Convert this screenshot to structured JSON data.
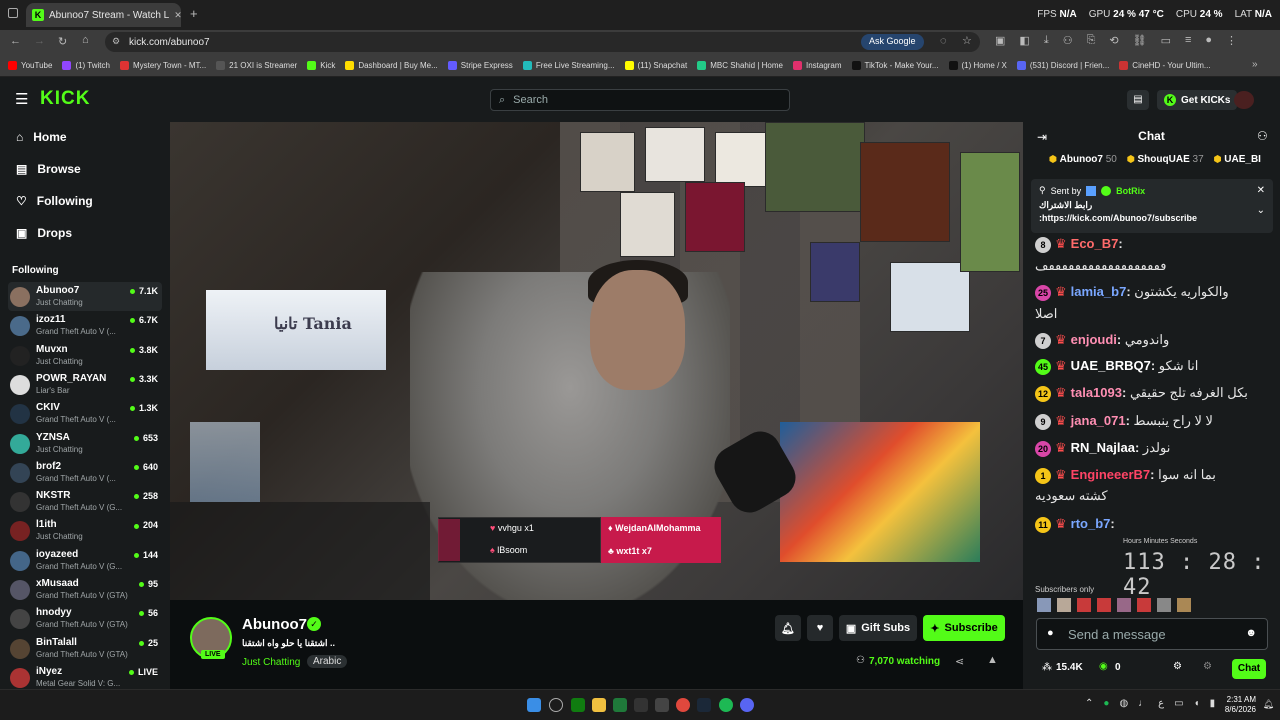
{
  "browser": {
    "tab_title": "Abunoo7 Stream - Watch L",
    "url": "kick.com/abunoo7",
    "ask_google": "Ask Google",
    "hud": {
      "fps_label": "FPS",
      "fps": "N/A",
      "gpu_label": "GPU",
      "gpu": "24 % 47 °C",
      "cpu_label": "CPU",
      "cpu": "24 %",
      "lat_label": "LAT",
      "lat": "N/A"
    },
    "bookmarks": [
      {
        "label": "YouTube",
        "color": "#ff0000"
      },
      {
        "label": "(1) Twitch",
        "color": "#9146ff"
      },
      {
        "label": "Mystery Town - MT...",
        "color": "#d33"
      },
      {
        "label": "21 OXI is Streamer",
        "color": "#555"
      },
      {
        "label": "Kick",
        "color": "#53fc18"
      },
      {
        "label": "Dashboard | Buy Me...",
        "color": "#ffdd00"
      },
      {
        "label": "Stripe Express",
        "color": "#635bff"
      },
      {
        "label": "Free Live Streaming...",
        "color": "#2bb"
      },
      {
        "label": "(11) Snapchat",
        "color": "#fffc00"
      },
      {
        "label": "MBC Shahid | Home",
        "color": "#2c8"
      },
      {
        "label": "Instagram",
        "color": "#e1306c"
      },
      {
        "label": "TikTok - Make Your...",
        "color": "#111"
      },
      {
        "label": "(1) Home / X",
        "color": "#111"
      },
      {
        "label": "(531) Discord | Frien...",
        "color": "#5865f2"
      },
      {
        "label": "CineHD - Your Ultim...",
        "color": "#c33"
      }
    ]
  },
  "kick": {
    "logo": "KICK",
    "search_placeholder": "Search",
    "get_kicks": "Get KICKs",
    "nav": [
      "Home",
      "Browse",
      "Following",
      "Drops"
    ],
    "following_header": "Following",
    "following": [
      {
        "name": "Abunoo7",
        "category": "Just Chatting",
        "viewers": "7.1K",
        "color": "#8a7060"
      },
      {
        "name": "izoz11",
        "category": "Grand Theft Auto V (...",
        "viewers": "6.7K",
        "color": "#4a6a8a"
      },
      {
        "name": "Muvxn",
        "category": "Just Chatting",
        "viewers": "3.8K",
        "color": "#222"
      },
      {
        "name": "POWR_RAYAN",
        "category": "Liar's Bar",
        "viewers": "3.3K",
        "color": "#ddd"
      },
      {
        "name": "CKIV",
        "category": "Grand Theft Auto V (...",
        "viewers": "1.3K",
        "color": "#234"
      },
      {
        "name": "YZNSA",
        "category": "Just Chatting",
        "viewers": "653",
        "color": "#3a9"
      },
      {
        "name": "brof2",
        "category": "Grand Theft Auto V (...",
        "viewers": "640",
        "color": "#345"
      },
      {
        "name": "NKSTR",
        "category": "Grand Theft Auto V (G...",
        "viewers": "258",
        "color": "#333"
      },
      {
        "name": "l1ith",
        "category": "Just Chatting",
        "viewers": "204",
        "color": "#722"
      },
      {
        "name": "ioyazeed",
        "category": "Grand Theft Auto V (G...",
        "viewers": "144",
        "color": "#468"
      },
      {
        "name": "xMusaad",
        "category": "Grand Theft Auto V (GTA)",
        "viewers": "95",
        "color": "#556"
      },
      {
        "name": "hnodyy",
        "category": "Grand Theft Auto V (GTA)",
        "viewers": "56",
        "color": "#444"
      },
      {
        "name": "BinTalall",
        "category": "Grand Theft Auto V (GTA)",
        "viewers": "25",
        "color": "#543"
      },
      {
        "name": "iNyez",
        "category": "Metal Gear Solid V: G...",
        "viewers": "LIVE",
        "color": "#a33"
      }
    ]
  },
  "video": {
    "tv_text": "تانيا Tania",
    "alert": {
      "left1": "vvhgu x1",
      "left2": "lBsoom",
      "right1": "WejdanAlMohamma",
      "right2": "wxt1t x7"
    }
  },
  "streamer": {
    "name": "Abunoo7",
    "live": "LIVE",
    "title": "اشتقنا يا حلو واه اشتقنا ..",
    "category": "Just Chatting",
    "language": "Arabic",
    "gift_subs": "Gift Subs",
    "subscribe": "Subscribe",
    "watching": "7,070 watching"
  },
  "chat": {
    "header": "Chat",
    "leaderboard": [
      {
        "name": "Abunoo7",
        "value": "50"
      },
      {
        "name": "ShouqUAE",
        "value": "37"
      },
      {
        "name": "UAE_BI",
        "value": ""
      }
    ],
    "pinned": {
      "sent_by": "Sent by",
      "bot": "BotRix",
      "line1": "رابط الاشتراك",
      "link": ":https://kick.com/Abunoo7/subscribe"
    },
    "messages": [
      {
        "badge": "8",
        "badge_color": "#cfcfcf",
        "user": "Eco_B7",
        "user_color": "#ff6b6b",
        "text": ""
      },
      {
        "badge": "",
        "badge_color": "",
        "user": "",
        "user_color": "",
        "text": "ڡڡڡڡڡڡڡڡڡڡڡڡڡڡڡڡڡڡڡ"
      },
      {
        "badge": "25",
        "badge_color": "#d946a8",
        "user": "lamia_b7",
        "user_color": "#7aa7ff",
        "text": "والكواريه يكشتون"
      },
      {
        "badge": "",
        "badge_color": "",
        "user": "",
        "user_color": "",
        "text": "اصلا"
      },
      {
        "badge": "7",
        "badge_color": "#cfcfcf",
        "user": "enjoudi",
        "user_color": "#ff8fb3",
        "text": "واندومي"
      },
      {
        "badge": "45",
        "badge_color": "#53fc18",
        "user": "UAE_BRBQ7",
        "user_color": "#ffffff",
        "text": "انا شكو"
      },
      {
        "badge": "12",
        "badge_color": "#f5c518",
        "user": "tala1093",
        "user_color": "#ff8fb3",
        "text": "بكل الغرفه تلج حقيقي"
      },
      {
        "badge": "9",
        "badge_color": "#cfcfcf",
        "user": "jana_071",
        "user_color": "#ff8fb3",
        "text": "لا لا راح ينبسط"
      },
      {
        "badge": "20",
        "badge_color": "#d946a8",
        "user": "RN_Najlaa",
        "user_color": "#ffffff",
        "text": "نولدز"
      },
      {
        "badge": "1",
        "badge_color": "#f5c518",
        "user": "EngineeerB7",
        "user_color": "#ff4466",
        "text": "بما انه سوا"
      },
      {
        "badge": "",
        "badge_color": "",
        "user": "",
        "user_color": "",
        "text": "كشته سعوديه"
      },
      {
        "badge": "11",
        "badge_color": "#f5c518",
        "user": "rto_b7",
        "user_color": "#7aa7ff",
        "text": ""
      }
    ],
    "clock": "113 : 28 : 42",
    "clock_labels": "Hours   Minutes   Seconds",
    "subscribers_on": "Subscribers only",
    "send_placeholder": "Send a message",
    "footer_count": "15.4K",
    "footer_kicks": "0",
    "chat_button": "Chat"
  },
  "taskbar": {
    "lang": "ع",
    "time": "2:31 AM",
    "date": "8/6/2026"
  }
}
